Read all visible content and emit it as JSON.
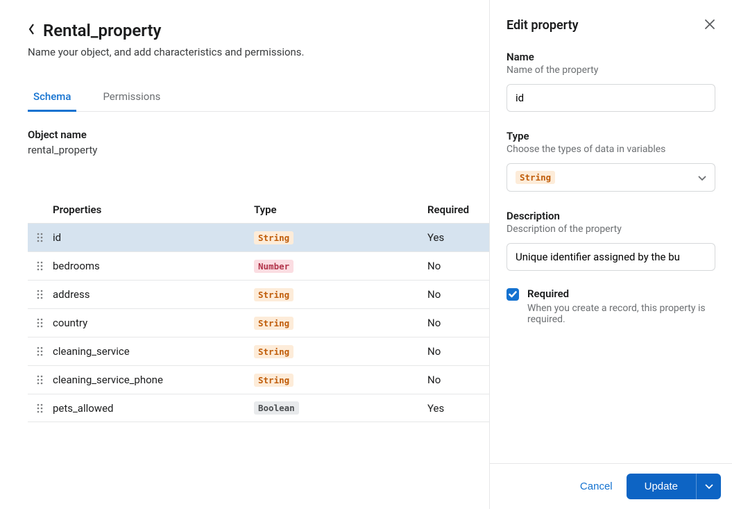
{
  "header": {
    "title": "Rental_property",
    "subtitle": "Name your object, and add characteristics and permissions."
  },
  "tabs": [
    {
      "label": "Schema",
      "active": true
    },
    {
      "label": "Permissions",
      "active": false
    }
  ],
  "object": {
    "name_label": "Object name",
    "name_value": "rental_property"
  },
  "columns": {
    "properties": "Properties",
    "type": "Type",
    "required": "Required"
  },
  "rows": [
    {
      "name": "id",
      "type": "String",
      "type_class": "string",
      "required": "Yes",
      "selected": true
    },
    {
      "name": "bedrooms",
      "type": "Number",
      "type_class": "number",
      "required": "No",
      "selected": false
    },
    {
      "name": "address",
      "type": "String",
      "type_class": "string",
      "required": "No",
      "selected": false
    },
    {
      "name": "country",
      "type": "String",
      "type_class": "string",
      "required": "No",
      "selected": false
    },
    {
      "name": "cleaning_service",
      "type": "String",
      "type_class": "string",
      "required": "No",
      "selected": false
    },
    {
      "name": "cleaning_service_phone",
      "type": "String",
      "type_class": "string",
      "required": "No",
      "selected": false
    },
    {
      "name": "pets_allowed",
      "type": "Boolean",
      "type_class": "boolean",
      "required": "Yes",
      "selected": false
    }
  ],
  "panel": {
    "title": "Edit property",
    "name": {
      "label": "Name",
      "hint": "Name of the property",
      "value": "id"
    },
    "type": {
      "label": "Type",
      "hint": "Choose the types of data in variables",
      "value": "String",
      "value_class": "string"
    },
    "description": {
      "label": "Description",
      "hint": "Description of the property",
      "value": "Unique identifier assigned by the bu"
    },
    "required": {
      "label": "Required",
      "hint": "When you create a record, this property is required.",
      "checked": true
    },
    "footer": {
      "cancel": "Cancel",
      "update": "Update"
    }
  }
}
